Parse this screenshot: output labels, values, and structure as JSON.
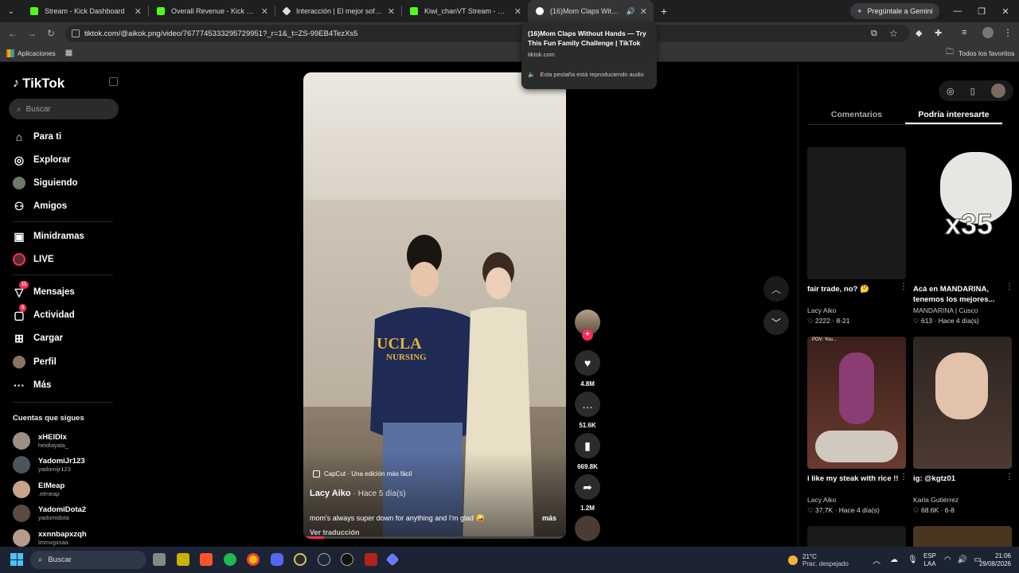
{
  "browser": {
    "tabs": [
      {
        "title": "Stream - Kick Dashboard",
        "color": "#53fc18"
      },
      {
        "title": "Overall Revenue - Kick Dashboa",
        "color": "#53fc18"
      },
      {
        "title": "Interacción | El mejor software",
        "color": "#dddddd"
      },
      {
        "title": "Kiwi_chanVT Stream - Watch Li",
        "color": "#53fc18"
      },
      {
        "title": "(16)Mom Claps Without Ha",
        "color": "#ffffff",
        "active": true
      }
    ],
    "gemini_label": "Pregúntale a Gemini",
    "url": "tiktok.com/@aikok.png/video/7677745333295729951?_r=1&_t=ZS-99EB4TezXs5",
    "bookmarks_apps": "Aplicaciones",
    "bookmarks_all": "Todos los favoritos"
  },
  "tooltip": {
    "title": "(16)Mom Claps Without Hands — Try This Fun Family Challenge | TikTok",
    "domain": "tiktok.com",
    "audio_note": "Esta pestaña está reproduciendo audio"
  },
  "sidebar": {
    "logo": "TikTok",
    "search_placeholder": "Buscar",
    "nav": [
      {
        "label": "Para ti",
        "icon": "home-icon"
      },
      {
        "label": "Explorar",
        "icon": "compass-icon"
      },
      {
        "label": "Siguiendo",
        "icon": "following-avatar-icon"
      },
      {
        "label": "Amigos",
        "icon": "friends-icon"
      },
      {
        "label": "Minidramas",
        "icon": "film-icon"
      },
      {
        "label": "LIVE",
        "icon": "live-icon"
      },
      {
        "label": "Mensajes",
        "icon": "inbox-icon",
        "badge": "11"
      },
      {
        "label": "Actividad",
        "icon": "bell-icon",
        "badge": "5"
      },
      {
        "label": "Cargar",
        "icon": "upload-icon"
      },
      {
        "label": "Perfil",
        "icon": "profile-avatar-icon"
      },
      {
        "label": "Más",
        "icon": "more-icon"
      }
    ],
    "following_title": "Cuentas que sigues",
    "following": [
      {
        "name": "xHEIDIx",
        "handle": "heidiayala_"
      },
      {
        "name": "YadomiJr123",
        "handle": "yadomijr123"
      },
      {
        "name": "ElMeap",
        "handle": ".elmeap"
      },
      {
        "name": "YadomiDota2",
        "handle": "yadomidota"
      },
      {
        "name": "xxnnbapxzqh",
        "handle": "lmmvgxsaa"
      }
    ]
  },
  "video": {
    "shirt_text_1": "UCLA",
    "shirt_text_2": "NURSING",
    "capcut": "CapCut · Una edición más fácil",
    "author": "Lacy Aiko",
    "when": "· Hace 5 día(s)",
    "description": "mom's always super down for anything and I'm glad 🤪",
    "more": "más",
    "translate": "Ver traducción",
    "progress": 0.08
  },
  "actions": {
    "likes": "4.8M",
    "comments": "51.6K",
    "saves": "669.8K",
    "shares": "1.2M"
  },
  "right_panel": {
    "tab_comments": "Comentarios",
    "tab_interest": "Podría interesarte",
    "cards": [
      {
        "title": "fair trade, no? 🤔",
        "author": "Lacy Aiko",
        "stats": "♡ 2222 · 8-21",
        "bg": "#1a1a1a"
      },
      {
        "title": "Acá en MANDARINA, tenemos los mejores...",
        "author": "MANDARINA | Cusco",
        "stats": "♡ 613 · Hace 4 día(s)",
        "bg": "#000000",
        "overlay": "x35"
      },
      {
        "title": "i like my steak with rice !!",
        "author": "Lacy Aiko",
        "stats": "♡ 37.7K · Hace 4 día(s)",
        "bg": "#5a2a22",
        "overlay": "POV: You..."
      },
      {
        "title": "ig: @kgtz01",
        "author": "Karla Gutiérrez",
        "stats": "♡ 68.6K · 6-8",
        "bg": "#3a2a24"
      }
    ]
  },
  "taskbar": {
    "search": "Buscar",
    "weather_temp": "21°C",
    "weather_desc": "Prac. despejado",
    "lang": "ESP",
    "lang2": "LAA",
    "time": "21:06",
    "date": "29/08/2026"
  }
}
